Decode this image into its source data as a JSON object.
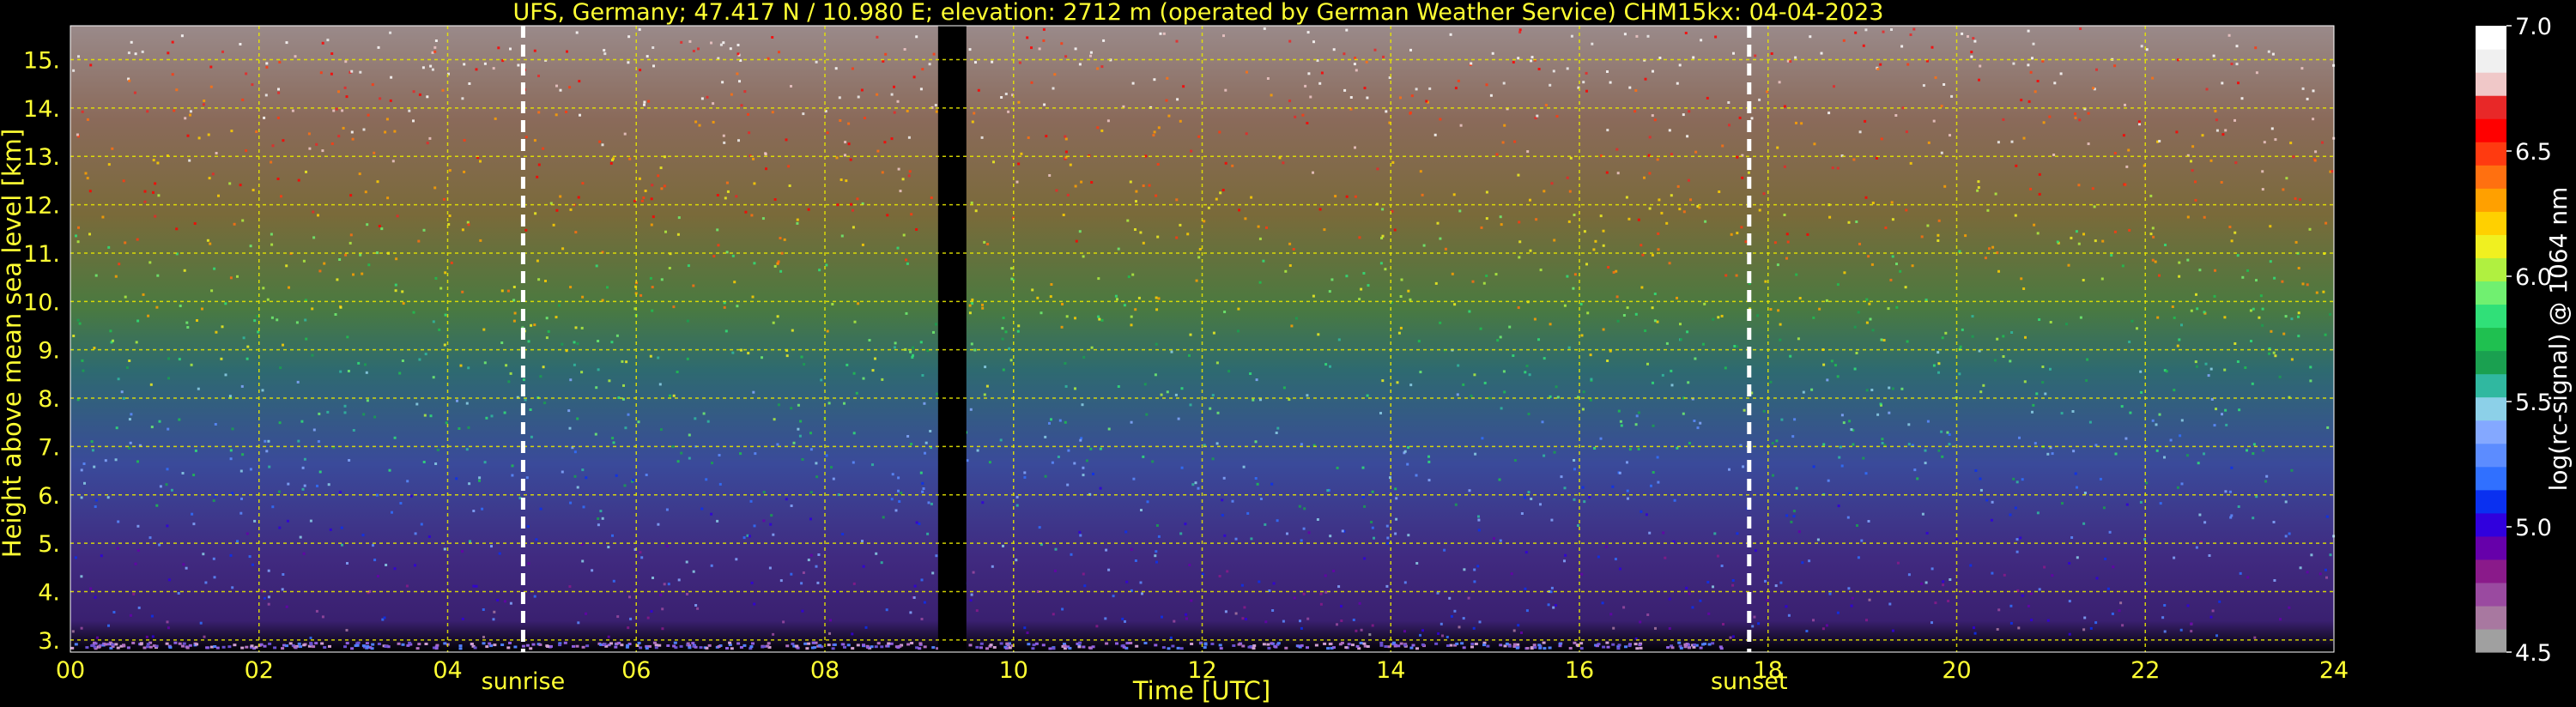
{
  "chart_data": {
    "type": "heatmap",
    "title": "UFS, Germany; 47.417 N / 10.980 E; elevation: 2712 m  (operated by German Weather Service)    CHM15kx: 04-04-2023",
    "xlabel": "Time [UTC]",
    "ylabel": "Height above mean sea level [km]",
    "xlim": [
      0,
      24
    ],
    "ylim": [
      2.75,
      15.7
    ],
    "x_ticks": [
      "00",
      "02",
      "04",
      "06",
      "08",
      "10",
      "12",
      "14",
      "16",
      "18",
      "20",
      "22",
      "24"
    ],
    "y_ticks": [
      "3.",
      "4.",
      "5.",
      "6.",
      "7.",
      "8.",
      "9.",
      "10.",
      "11.",
      "12.",
      "13.",
      "14.",
      "15."
    ],
    "grid": true,
    "data_gap_hours": [
      9.2,
      9.5
    ],
    "annotations": [
      {
        "label": "sunrise",
        "x_hours": 4.8
      },
      {
        "label": "sunset",
        "x_hours": 17.8
      }
    ],
    "colorbar": {
      "label": "log(rc-signal) @ 1064 nm",
      "range": [
        4.5,
        7.0
      ],
      "ticks": [
        "4.5",
        "5.0",
        "5.5",
        "6.0",
        "6.5",
        "7.0"
      ],
      "colors": [
        "#a0a0a0",
        "#a878a0",
        "#9a4aa0",
        "#8a1a8a",
        "#6600aa",
        "#3000dd",
        "#0a30f0",
        "#3070ff",
        "#5c8cff",
        "#84a8ff",
        "#8cd0e8",
        "#30b8a0",
        "#1aa050",
        "#1fc050",
        "#30e078",
        "#70f070",
        "#b0f040",
        "#f0f020",
        "#ffd000",
        "#ffa000",
        "#ff7010",
        "#ff3a10",
        "#ff0000",
        "#e82828",
        "#f0c8c8",
        "#f0f0f0",
        "#ffffff"
      ]
    }
  }
}
